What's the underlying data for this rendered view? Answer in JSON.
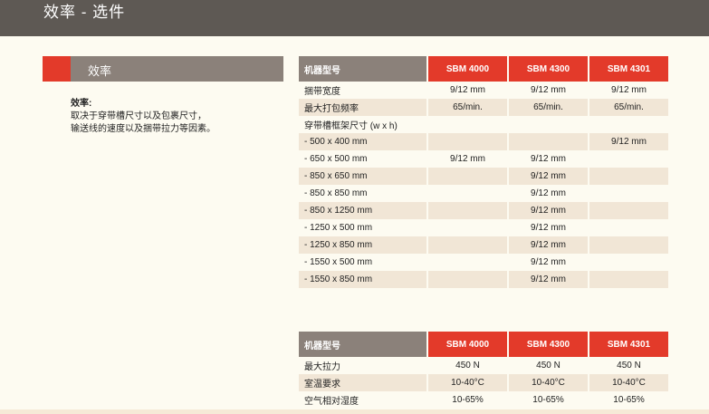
{
  "header": {
    "title": "效率  -  选件"
  },
  "section": {
    "label": "效率"
  },
  "description": {
    "heading": "效率:",
    "line1": "取决于穿带槽尺寸以及包裹尺寸，",
    "line2": "输送线的速度以及捆带拉力等因素。"
  },
  "table1": {
    "header": [
      "机器型号",
      "SBM 4000",
      "SBM 4300",
      "SBM 4301"
    ],
    "rows": [
      [
        "捆带宽度",
        "9/12 mm",
        "9/12 mm",
        "9/12 mm"
      ],
      [
        "最大打包频率",
        "65/min.",
        "65/min.",
        "65/min."
      ],
      [
        "穿带槽框架尺寸 (w x h)",
        "",
        "",
        ""
      ],
      [
        "-   500 x   400 mm",
        "",
        "",
        "9/12 mm"
      ],
      [
        "-   650 x   500 mm",
        "9/12 mm",
        "9/12 mm",
        ""
      ],
      [
        "-   850 x   650 mm",
        "",
        "9/12 mm",
        ""
      ],
      [
        "-   850 x   850 mm",
        "",
        "9/12 mm",
        ""
      ],
      [
        "-   850 x  1250 mm",
        "",
        "9/12 mm",
        ""
      ],
      [
        "- 1250 x   500 mm",
        "",
        "9/12 mm",
        ""
      ],
      [
        "- 1250 x   850 mm",
        "",
        "9/12 mm",
        ""
      ],
      [
        "- 1550 x   500 mm",
        "",
        "9/12 mm",
        ""
      ],
      [
        "- 1550 x   850 mm",
        "",
        "9/12 mm",
        ""
      ]
    ]
  },
  "table2": {
    "header": [
      "机器型号",
      "SBM 4000",
      "SBM 4300",
      "SBM 4301"
    ],
    "rows": [
      [
        "最大拉力",
        "450 N",
        "450 N",
        "450 N"
      ],
      [
        "室温要求",
        "10-40°C",
        "10-40°C",
        "10-40°C"
      ],
      [
        "空气相对湿度",
        "10-65%",
        "10-65%",
        "10-65%"
      ]
    ]
  }
}
